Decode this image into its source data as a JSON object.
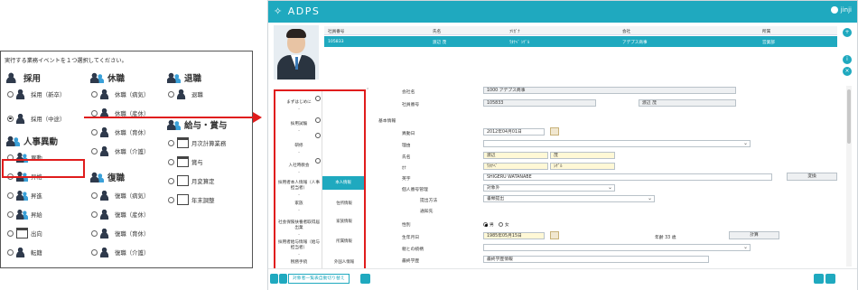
{
  "event_card": {
    "prompt": "実行する業務イベントを１つ選択してください。",
    "groups": {
      "hire": {
        "title": "採用",
        "options": [
          "採用（新卒）",
          "採用（中途）"
        ]
      },
      "leave": {
        "title": "休職",
        "options": [
          "休職（病気）",
          "休職（産休）",
          "休職（育休）",
          "休職（介護）"
        ]
      },
      "retire": {
        "title": "退職",
        "options": [
          "退職"
        ]
      },
      "transfer": {
        "title": "人事異動",
        "options": [
          "異動",
          "昇格",
          "昇進",
          "昇給",
          "出向",
          "転籍"
        ]
      },
      "return": {
        "title": "復職",
        "options": [
          "復職（病気）",
          "復職（産休）",
          "復職（育休）",
          "復職（介護）"
        ]
      },
      "payroll": {
        "title": "給与・賞与",
        "options": [
          "月次計算業務",
          "賞与",
          "月変算定",
          "年末調整"
        ]
      }
    },
    "selected": "採用（中途）"
  },
  "app": {
    "logo": "ADPS",
    "user": "jinji",
    "grid": {
      "headers": [
        "社員番号",
        "氏名",
        "ﾌﾘｶﾞﾅ",
        "会社",
        "所属"
      ],
      "row": [
        "105833",
        "渡辺 茂",
        "ﾜﾀﾅﾍﾞ ｼｹﾞﾙ",
        "アデプス商事",
        "営業部"
      ]
    },
    "steps": [
      {
        "label": "まずはじめに"
      },
      {
        "label": "採用試験"
      },
      {
        "label": "研修"
      },
      {
        "label": "入社時教会"
      },
      {
        "label": "採用者本人情報（人事担当者）"
      },
      {
        "label": "家族"
      },
      {
        "label": "社会保険扶養者取得届出業"
      },
      {
        "label": "採用者給与情報（給与担当者）"
      },
      {
        "label": "税務手続"
      }
    ],
    "substeps": [
      "本人情報",
      "住所情報",
      "家族情報",
      "所属情報",
      "外国人情報"
    ],
    "form": {
      "company_label": "会社名",
      "company_value": "1000 アデプス商事",
      "empno_label": "社員番号",
      "empno_value": "105833",
      "empname_value": "渡辺 茂",
      "section_basic": "基本情報",
      "hire_date_label": "異動日",
      "hire_date_value": "2012年04月01日",
      "reason_label": "理由",
      "name_label": "氏名",
      "last_name": "渡辺",
      "first_name": "茂",
      "kana_label": "ｶﾅ",
      "kana_last": "ﾜﾀﾅﾍﾞ",
      "kana_first": "ｼｹﾞﾙ",
      "roman_label": "英字",
      "roman_value": "SHIGERU WATANABE",
      "convert_button": "変換",
      "mynum_label": "個人番号管理",
      "mynum_value": "対象外",
      "method_label": "提出方法",
      "method_value": "書類提出",
      "notice_label": "通知先",
      "gender_label": "性別",
      "gender_male": "男",
      "gender_female": "女",
      "birth_label": "生年月日",
      "birth_value": "1985年05月15日",
      "age_text": "年齢 33 歳",
      "calc_button": "計算",
      "spouse_label": "親との続柄",
      "school_label": "最終学歴",
      "school_value": "最終学歴情報"
    },
    "footer_link": "対象者一覧表自動切り替え"
  },
  "colors": {
    "accent": "#1fa9bf",
    "highlight": "#e01c1c"
  }
}
